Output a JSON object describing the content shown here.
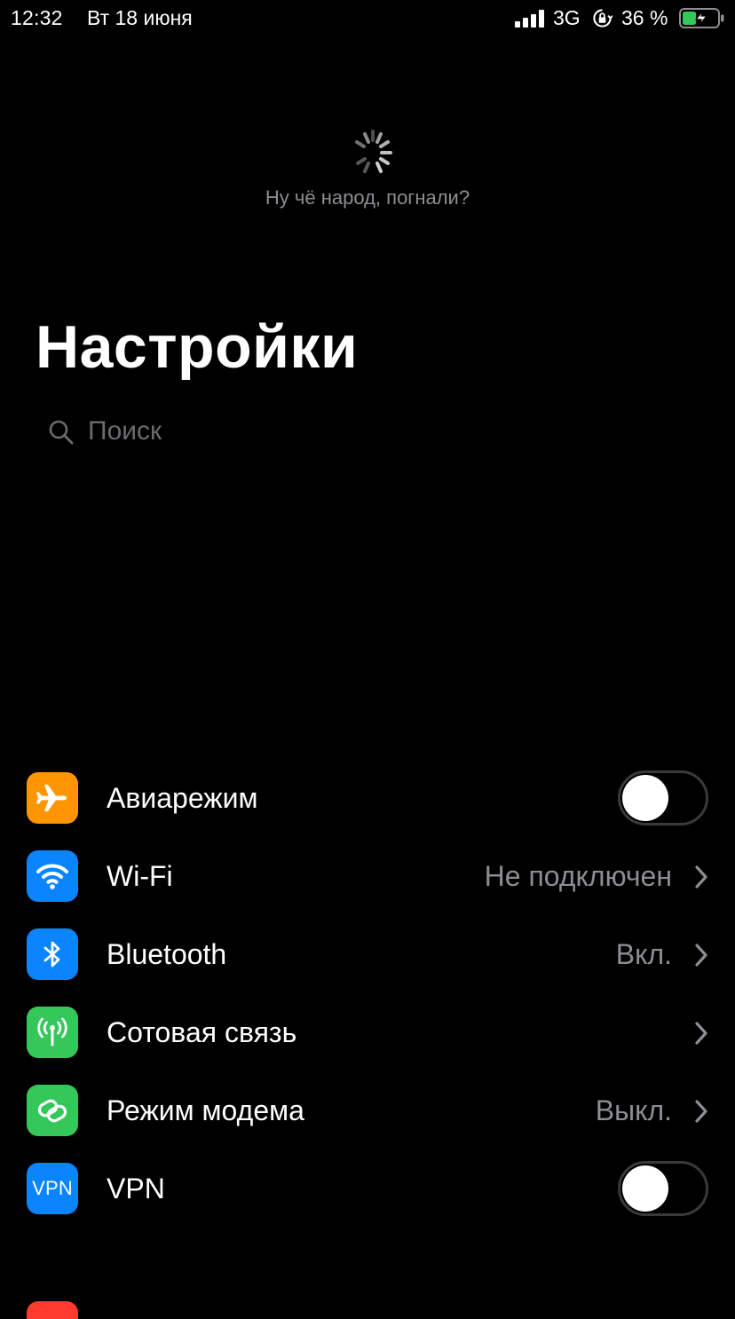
{
  "status_bar": {
    "time": "12:32",
    "date": "Вт 18 июня",
    "network": "3G",
    "battery_percent": "36 %",
    "icons": [
      "signal-bars-icon",
      "orientation-lock-icon",
      "battery-charging-icon"
    ]
  },
  "refresh": {
    "message": "Ну чё народ, погнали?"
  },
  "header": {
    "title": "Настройки"
  },
  "search": {
    "placeholder": "Поиск"
  },
  "settings": [
    {
      "label": "Авиарежим",
      "icon": "airplane-icon",
      "icon_color": "#ff9500",
      "control": "toggle",
      "toggle_on": false
    },
    {
      "label": "Wi-Fi",
      "icon": "wifi-icon",
      "icon_color": "#0a84ff",
      "value": "Не подключен",
      "control": "chevron"
    },
    {
      "label": "Bluetooth",
      "icon": "bluetooth-icon",
      "icon_color": "#0a84ff",
      "value": "Вкл.",
      "control": "chevron"
    },
    {
      "label": "Сотовая связь",
      "icon": "cellular-antenna-icon",
      "icon_color": "#34c759",
      "control": "chevron"
    },
    {
      "label": "Режим модема",
      "icon": "personal-hotspot-icon",
      "icon_color": "#34c759",
      "value": "Выкл.",
      "control": "chevron"
    },
    {
      "label": "VPN",
      "icon": "vpn-icon",
      "icon_color": "#0a84ff",
      "icon_text": "VPN",
      "control": "toggle",
      "toggle_on": false
    }
  ],
  "colors": {
    "background": "#000000",
    "secondary_text": "#8d8d93",
    "toggle_border": "#3a3a3c",
    "battery_fill": "#34c759"
  }
}
